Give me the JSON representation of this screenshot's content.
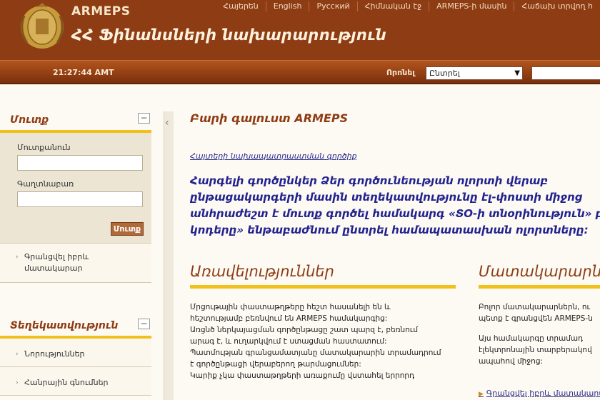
{
  "header": {
    "brand": "ARMEPS",
    "ministry": "ՀՀ Ֆինանսների նախարարություն",
    "nav": [
      "Հայերեն",
      "English",
      "Русский",
      "Հիմնական էջ",
      "ARMEPS-ի մասին",
      "Հաճախ տրվող հ"
    ]
  },
  "statusbar": {
    "clock": "21:27:44 AMT",
    "search_label": "Որոնել",
    "search_select": "Ընտրել"
  },
  "sidebar": {
    "login_title": "Մուտք",
    "username_label": "Մուտքանուն",
    "password_label": "Գաղտնաբառ",
    "login_button": "Մուտք",
    "register_link": "Գրանցվել իբրև մատակարար",
    "info_title": "Տեղեկատվություն",
    "news_link": "Նորություններ",
    "general_link": "Հանրային գնումներ"
  },
  "main": {
    "welcome": "Բարի գալուստ ARMEPS",
    "breadcrumb": "Հայտերի նախապատրաստման գործիք",
    "intro": [
      "Հարգելի գործընկեր Ձեր գործունեության ոլորտի վերաբ",
      "ընթացակարգերի մասին տեղեկատվությունը էլ-փոստի միջոց",
      "անհրաժեշտ է մուտք գործել համակարգ «ՏՕ-ի տնօրինություն» բա",
      "կոդերը» ենթաբաժնում ընտրել համապատասխան ոլորտները:"
    ],
    "advantages_title": "Առավելություններ",
    "advantages_body": [
      "Մրցութային փաստաթղթերը հեշտ հասանելի են և",
      "հեշտությամբ բեռնվում են ARMEPS համակարգից:",
      "Առցնծ ներկայացման գործընթացը շատ պարզ է, բեռնում",
      "արագ է, և ուղարկվում է ստացման հաստատում:",
      "Պատմության գրանցամատյանը մատակարարին տրամադրում",
      "է գործընթացի վերաբերող թարմացումներ:",
      "Կարիք չկա փաստաթղթերի առաքումը վստահել երրորդ"
    ],
    "suppliers_title": "Մատակարարնե",
    "suppliers_body": [
      "Բոլոր մատակարարներն, ու",
      "պետք է գրանցվեն ARMEPS-ն",
      "Այս համակարգը տրամադ",
      "էլեկտրոնային տարբերակով",
      "ապահով միջոց:"
    ],
    "suppliers_link": "Գրանցվել իբրև մատակարար"
  }
}
